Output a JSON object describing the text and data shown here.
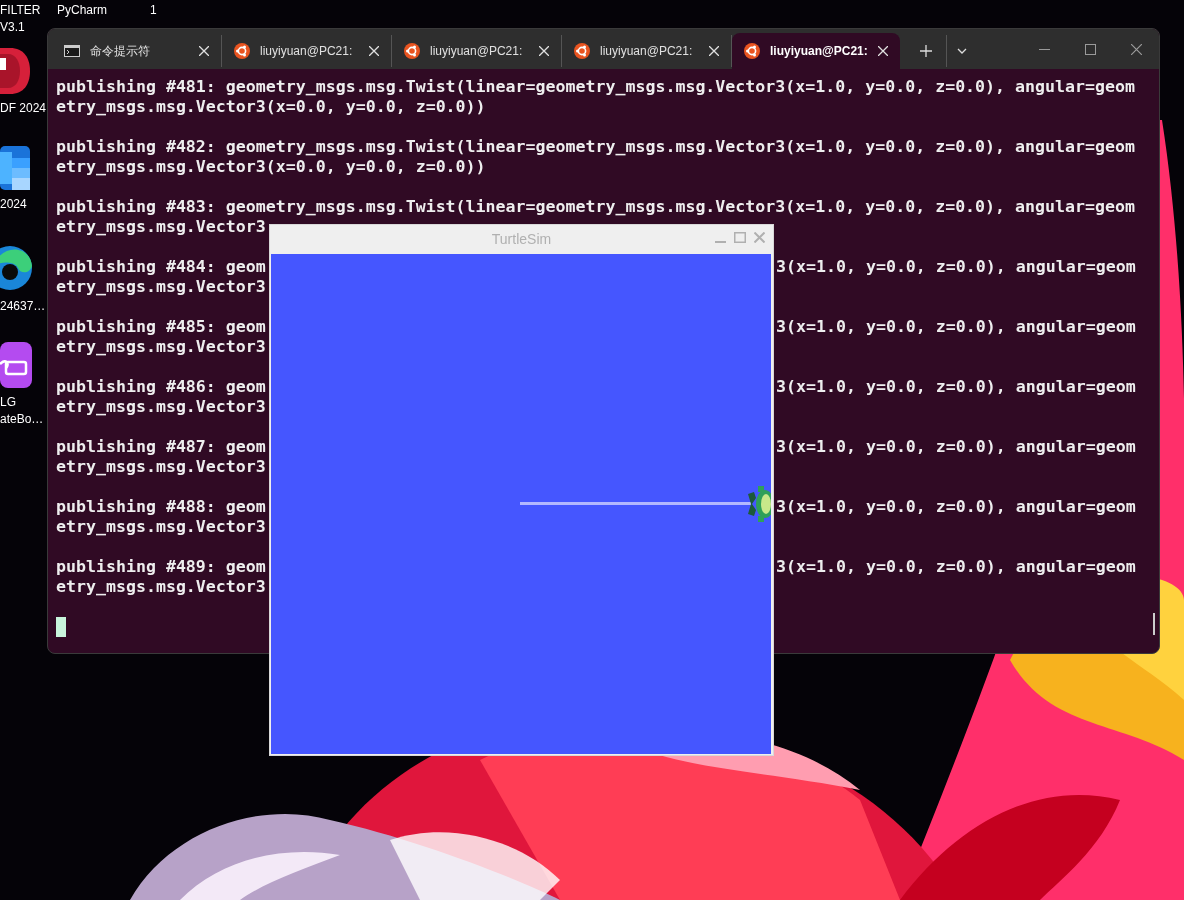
{
  "desktop_icons": [
    {
      "kind": "none",
      "labels": [
        "FILTER",
        "V3.1"
      ]
    },
    {
      "kind": "none",
      "labels": [
        "PyCharm"
      ]
    },
    {
      "kind": "none",
      "labels": [
        "1"
      ]
    },
    {
      "kind": "pdf",
      "labels": [
        "DF 2024"
      ]
    },
    {
      "kind": "office",
      "labels": [
        "2024"
      ]
    },
    {
      "kind": "edge",
      "labels": [
        "24637…"
      ]
    },
    {
      "kind": "board",
      "labels": [
        "LG",
        "ateBo…"
      ]
    }
  ],
  "terminal": {
    "tabs": [
      {
        "kind": "cmd",
        "title": "命令提示符",
        "selected": false
      },
      {
        "kind": "ubuntu",
        "title": "liuyiyuan@PC21:",
        "selected": false
      },
      {
        "kind": "ubuntu",
        "title": "liuyiyuan@PC21:",
        "selected": false
      },
      {
        "kind": "ubuntu",
        "title": "liuyiyuan@PC21:",
        "selected": false
      },
      {
        "kind": "ubuntu",
        "title": "liuyiyuan@PC21:",
        "selected": true
      }
    ],
    "messages": [
      {
        "lines": [
          {
            "text": "publishing #481: geometry_msgs.msg.Twist(linear=geometry_msgs.msg.Vector3(x=1.0, y=0.0, z=0.0), angular=geom"
          },
          {
            "text": "etry_msgs.msg.Vector3(x=0.0, y=0.0, z=0.0))"
          }
        ]
      },
      {
        "lines": [
          {
            "text": "publishing #482: geometry_msgs.msg.Twist(linear=geometry_msgs.msg.Vector3(x=1.0, y=0.0, z=0.0), angular=geom"
          },
          {
            "text": "etry_msgs.msg.Vector3(x=0.0, y=0.0, z=0.0))"
          }
        ]
      },
      {
        "lines": [
          {
            "text": "publishing #483: geometry_msgs.msg.Twist(linear=geometry_msgs.msg.Vector3(x=1.0, y=0.0, z=0.0), angular=geom"
          },
          {
            "text": "etry_msgs.msg.Vector3"
          }
        ]
      },
      {
        "lines": [
          {
            "text": "publishing #484: geom",
            "text_right": "3(x=1.0, y=0.0, z=0.0), angular=geom"
          },
          {
            "text": "etry_msgs.msg.Vector3"
          }
        ]
      },
      {
        "lines": [
          {
            "text": "publishing #485: geom",
            "text_right": "3(x=1.0, y=0.0, z=0.0), angular=geom"
          },
          {
            "text": "etry_msgs.msg.Vector3"
          }
        ]
      },
      {
        "lines": [
          {
            "text": "publishing #486: geom",
            "text_right": "3(x=1.0, y=0.0, z=0.0), angular=geom"
          },
          {
            "text": "etry_msgs.msg.Vector3"
          }
        ]
      },
      {
        "lines": [
          {
            "text": "publishing #487: geom",
            "text_right": "3(x=1.0, y=0.0, z=0.0), angular=geom"
          },
          {
            "text": "etry_msgs.msg.Vector3"
          }
        ]
      },
      {
        "lines": [
          {
            "text": "publishing #488: geom",
            "text_right": "3(x=1.0, y=0.0, z=0.0), angular=geom"
          },
          {
            "text": "etry_msgs.msg.Vector3"
          }
        ]
      },
      {
        "lines": [
          {
            "text": "publishing #489: geom",
            "text_right": "3(x=1.0, y=0.0, z=0.0), angular=geom"
          },
          {
            "text": "etry_msgs.msg.Vector3"
          }
        ]
      }
    ]
  },
  "turtlesim": {
    "title": "TurtleSim"
  }
}
